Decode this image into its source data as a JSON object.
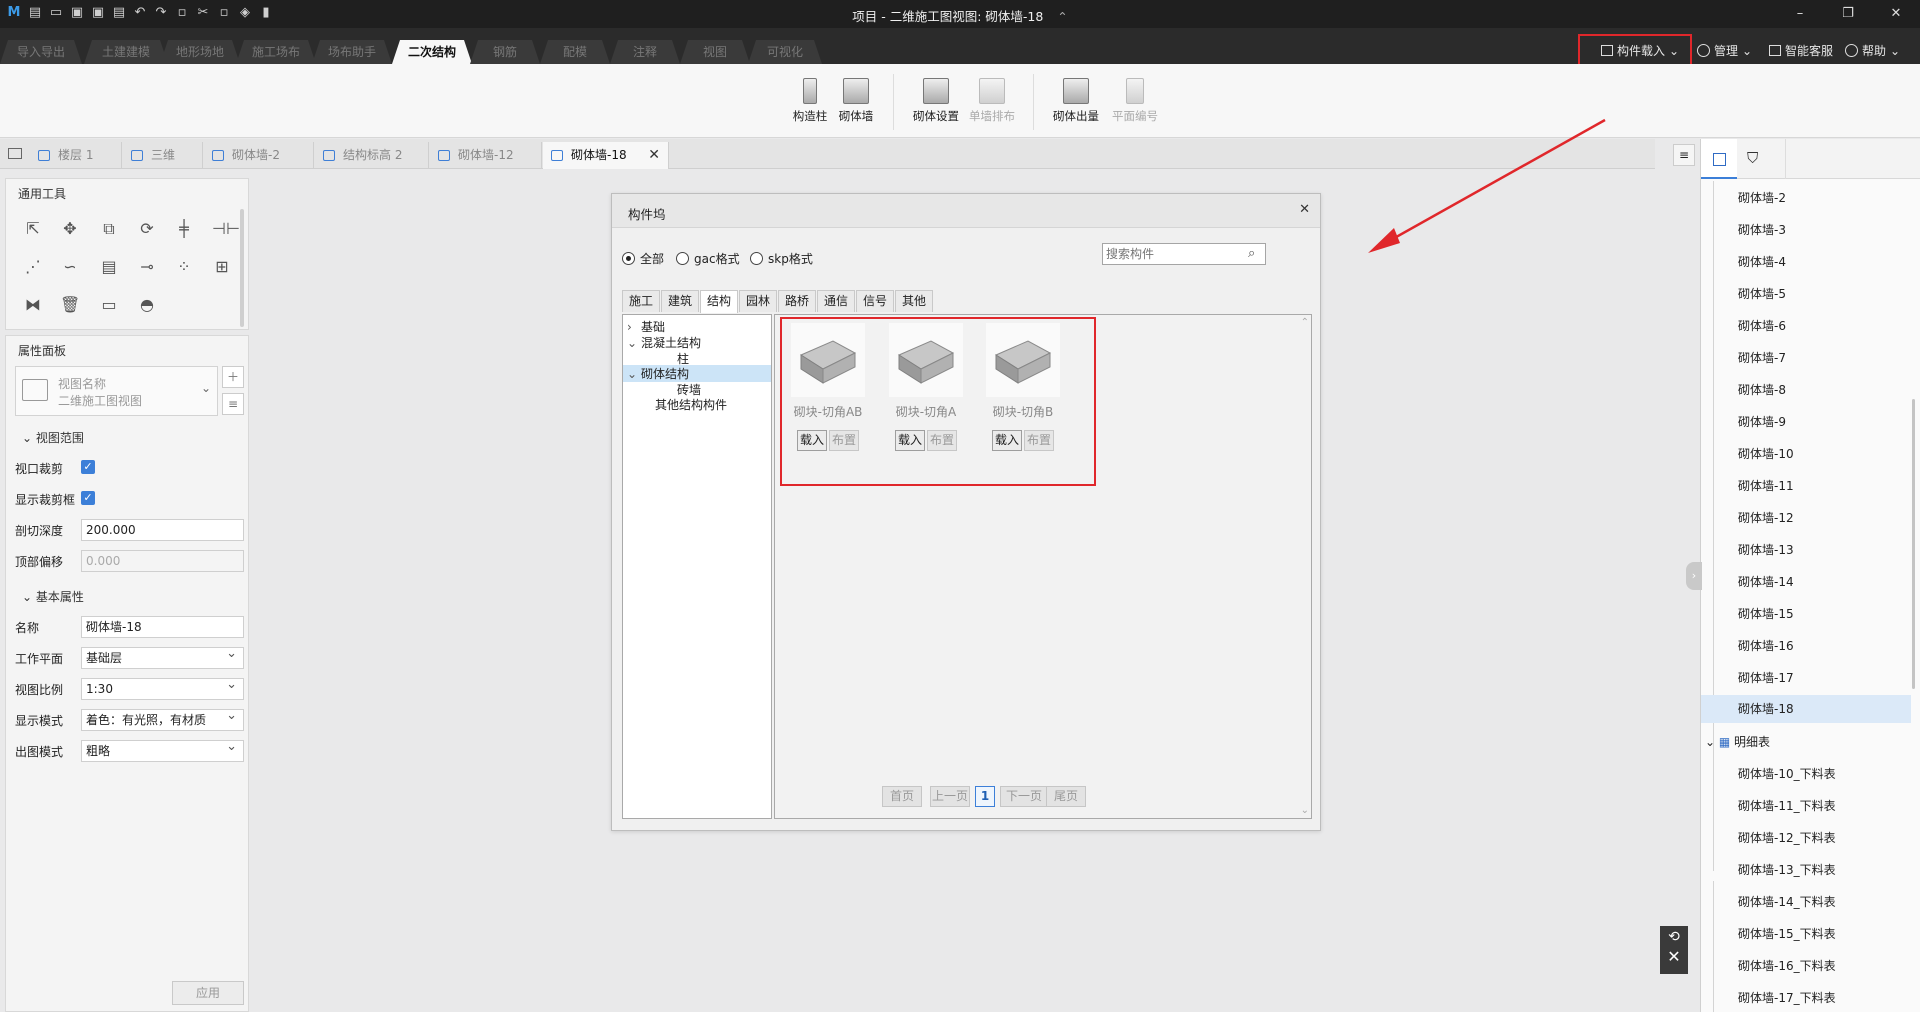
{
  "titlebar": {
    "title": "项目 - 二维施工图视图: 砌体墙-18",
    "title_suffix": "⌃",
    "quick_access_icons": [
      "app-logo-icon",
      "new-file-icon",
      "open-file-icon",
      "save-icon",
      "save-as-icon",
      "export-icon",
      "undo-icon",
      "redo-icon",
      "copy-icon",
      "cut-icon",
      "paste-icon",
      "stack-icon",
      "cube-icon"
    ],
    "window_buttons": {
      "minimize": "–",
      "restore": "❐",
      "close": "✕"
    }
  },
  "menubar": {
    "tabs": [
      {
        "label": "导入导出"
      },
      {
        "label": "土建建模"
      },
      {
        "label": "地形场地"
      },
      {
        "label": "施工场布"
      },
      {
        "label": "场布助手"
      },
      {
        "label": "二次结构"
      },
      {
        "label": "钢筋"
      },
      {
        "label": "配模"
      },
      {
        "label": "注释"
      },
      {
        "label": "视图"
      },
      {
        "label": "可视化"
      }
    ],
    "active_tab": "二次结构",
    "right_menu": [
      {
        "label": "构件载入"
      },
      {
        "label": "管理"
      },
      {
        "label": "智能客服"
      },
      {
        "label": "帮助"
      }
    ]
  },
  "ribbon": {
    "groups": [
      {
        "buttons": [
          {
            "label": "构造柱",
            "enabled": true
          },
          {
            "label": "砌体墙",
            "enabled": true
          }
        ]
      },
      {
        "buttons": [
          {
            "label": "砌体设置",
            "enabled": true
          },
          {
            "label": "单墙排布",
            "enabled": false
          }
        ]
      },
      {
        "buttons": [
          {
            "label": "砌体出量",
            "enabled": true
          },
          {
            "label": "平面编号",
            "enabled": false
          }
        ]
      }
    ]
  },
  "doc_tabs": [
    {
      "label": "楼层 1"
    },
    {
      "label": "三维"
    },
    {
      "label": "砌体墙-2"
    },
    {
      "label": "结构标高 2"
    },
    {
      "label": "砌体墙-12"
    },
    {
      "label": "砌体墙-18"
    }
  ],
  "active_doc_tab": "砌体墙-18",
  "tools_panel": {
    "title": "通用工具"
  },
  "props_panel": {
    "title": "属性面板",
    "view_selector": {
      "line1": "视图名称",
      "line2": "二维施工图视图"
    },
    "section_view_range": "视图范围",
    "crop_view": {
      "label": "视口裁剪",
      "checked": true
    },
    "show_crop_box": {
      "label": "显示裁剪框",
      "checked": true
    },
    "cut_depth": {
      "label": "剖切深度",
      "value": "200.000"
    },
    "top_offset": {
      "label": "顶部偏移",
      "value": "0.000"
    },
    "section_basic": "基本属性",
    "name": {
      "label": "名称",
      "value": "砌体墙-18"
    },
    "work_plane": {
      "label": "工作平面",
      "value": "基础层"
    },
    "view_scale": {
      "label": "视图比例",
      "value": "1:30"
    },
    "display_mode": {
      "label": "显示模式",
      "value": "着色：有光照，有材质"
    },
    "output_mode": {
      "label": "出图模式",
      "value": "粗略"
    },
    "apply_button": "应用"
  },
  "dialog": {
    "title": "构件坞",
    "close": "✕",
    "format_options": [
      {
        "label": "全部",
        "selected": true
      },
      {
        "label": "gac格式",
        "selected": false
      },
      {
        "label": "skp格式",
        "selected": false
      }
    ],
    "search_placeholder": "搜索构件",
    "category_tabs": [
      "施工",
      "建筑",
      "结构",
      "园林",
      "路桥",
      "通信",
      "信号",
      "其他"
    ],
    "active_category": "结构",
    "tree": [
      {
        "label": "基础",
        "expander": "›"
      },
      {
        "label": "混凝土结构",
        "expander": "⌄"
      },
      {
        "label": "柱",
        "expander": ""
      },
      {
        "label": "砌体结构",
        "expander": "⌄"
      },
      {
        "label": "砖墙",
        "expander": ""
      },
      {
        "label": "其他结构构件",
        "expander": ""
      }
    ],
    "selected_tree_node": "砌体结构",
    "cards": [
      {
        "label": "砌块-切角AB",
        "load": "载入",
        "place": "布置"
      },
      {
        "label": "砌块-切角A",
        "load": "载入",
        "place": "布置"
      },
      {
        "label": "砌块-切角B",
        "load": "载入",
        "place": "布置"
      }
    ],
    "pagination": {
      "first": "首页",
      "prev": "上一页",
      "current": "1",
      "next": "下一页",
      "last": "尾页"
    }
  },
  "right_panel": {
    "items": [
      "砌体墙-2",
      "砌体墙-3",
      "砌体墙-4",
      "砌体墙-5",
      "砌体墙-6",
      "砌体墙-7",
      "砌体墙-8",
      "砌体墙-9",
      "砌体墙-10",
      "砌体墙-11",
      "砌体墙-12",
      "砌体墙-13",
      "砌体墙-14",
      "砌体墙-15",
      "砌体墙-16",
      "砌体墙-17",
      "砌体墙-18"
    ],
    "selected_item": "砌体墙-18",
    "schedule_group": "明细表",
    "schedule_items": [
      "砌体墙-10_下料表",
      "砌体墙-11_下料表",
      "砌体墙-12_下料表",
      "砌体墙-13_下料表",
      "砌体墙-14_下料表",
      "砌体墙-15_下料表",
      "砌体墙-16_下料表",
      "砌体墙-17_下料表"
    ]
  },
  "colors": {
    "accent": "#3c7fd8",
    "highlight_box": "#e0272b",
    "titlebar": "#1f1f1f",
    "menubar": "#2b2b2b"
  }
}
